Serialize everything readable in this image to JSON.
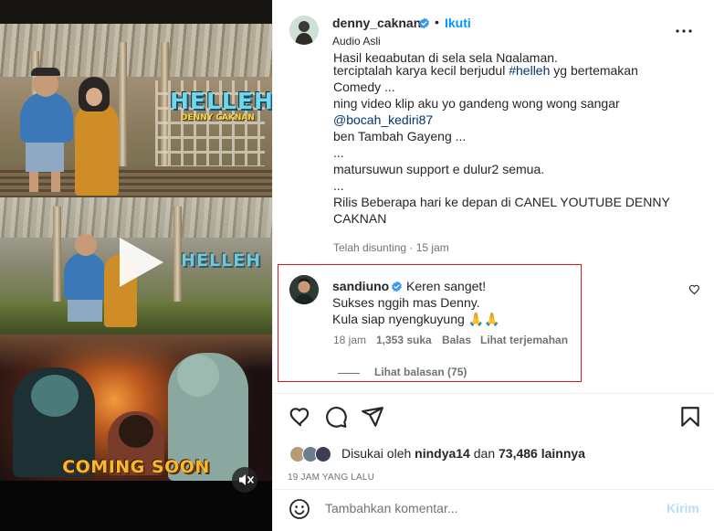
{
  "post": {
    "username": "denny_caknan",
    "follow_label": "Ikuti",
    "separator": "•",
    "audio_label": "Audio Asli",
    "caption_lines": [
      "Hasil kegabutan di sela sela Ngalaman,",
      "terciptalah karya kecil berjudul ",
      "Comedy ...",
      "ning video klip aku yo gandeng wong wong sangar",
      "@bocah_kediri87",
      "ben Tambah Gayeng ...",
      "...",
      "matursuwun support e dulur2 semua.",
      "...",
      "Rilis Beberapa hari ke depan di CANEL YOUTUBE DENNY",
      "CAKNAN"
    ],
    "caption_hashtag": "#helleh",
    "caption_after_hashtag": " yg bertemakan",
    "caption_meta": "Telah disunting · 15 jam"
  },
  "media": {
    "logo_text": "HELLEH",
    "logo_subtitle": "DENNY CAKNAN",
    "coming_soon": "COMING SOON"
  },
  "comment": {
    "username": "sandiuno",
    "lines": [
      "Keren sanget!",
      "Sukses nggih mas Denny.",
      "Kula siap nyengkuyung 🙏🙏"
    ],
    "time": "18 jam",
    "likes": "1,353 suka",
    "reply": "Balas",
    "translate": "Lihat terjemahan",
    "view_replies": "Lihat balasan (75)"
  },
  "engagement": {
    "liked_by_prefix": "Disukai oleh ",
    "liked_by_user": "nindya14",
    "liked_by_middle": " dan ",
    "liked_by_count": "73,486 lainnya",
    "date": "19 JAM YANG LALU"
  },
  "composer": {
    "placeholder": "Tambahkan komentar...",
    "post_label": "Kirim"
  },
  "icons": {
    "verified": "verified-badge-icon",
    "more": "more-options-icon",
    "like": "heart-icon",
    "comment": "comment-icon",
    "share": "send-icon",
    "save": "bookmark-icon",
    "emoji": "emoji-icon",
    "play": "play-icon",
    "mute": "muted-speaker-icon"
  },
  "colors": {
    "accent": "#0095f6",
    "verified": "#3897f0",
    "highlight_border": "#d81b20",
    "muted_text": "#737373",
    "link": "#00376b"
  }
}
